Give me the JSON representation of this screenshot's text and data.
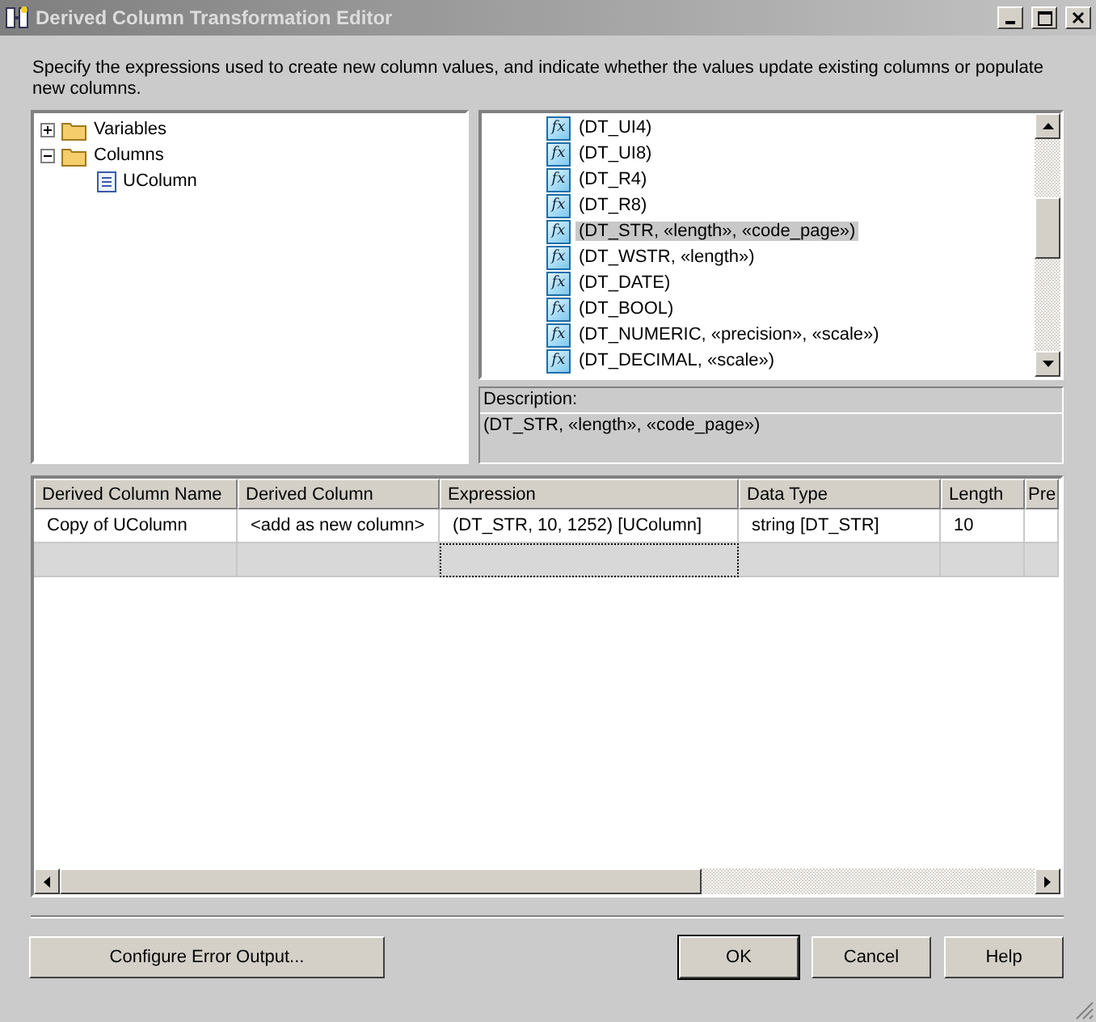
{
  "window": {
    "title": "Derived Column Transformation Editor"
  },
  "instructions": "Specify the expressions used to create new column values, and indicate whether the values update existing columns or populate new columns.",
  "tree": [
    {
      "label": "Variables",
      "kind": "folder",
      "expanded": false
    },
    {
      "label": "Columns",
      "kind": "folder",
      "expanded": true,
      "children": [
        {
          "label": "UColumn",
          "kind": "column"
        }
      ]
    }
  ],
  "functions": [
    {
      "icon": "fx",
      "label": "(DT_UI4)",
      "selected": false
    },
    {
      "icon": "fx",
      "label": "(DT_UI8)",
      "selected": false
    },
    {
      "icon": "fx",
      "label": "(DT_R4)",
      "selected": false
    },
    {
      "icon": "fx",
      "label": "(DT_R8)",
      "selected": false
    },
    {
      "icon": "fx",
      "label": "(DT_STR, «length», «code_page»)",
      "selected": true
    },
    {
      "icon": "fx",
      "label": "(DT_WSTR, «length»)",
      "selected": false
    },
    {
      "icon": "fx",
      "label": "(DT_DATE)",
      "selected": false
    },
    {
      "icon": "fx",
      "label": "(DT_BOOL)",
      "selected": false
    },
    {
      "icon": "fx",
      "label": "(DT_NUMERIC, «precision», «scale»)",
      "selected": false
    },
    {
      "icon": "fx",
      "label": "(DT_DECIMAL, «scale»)",
      "selected": false
    }
  ],
  "description": {
    "label": "Description:",
    "text": "(DT_STR, «length», «code_page»)"
  },
  "grid": {
    "columns": [
      {
        "label": "Derived Column Name",
        "focused": false
      },
      {
        "label": "Derived Column",
        "focused": false
      },
      {
        "label": "Expression",
        "focused": true
      },
      {
        "label": "Data Type",
        "focused": false
      },
      {
        "label": "Length",
        "focused": false
      },
      {
        "label": "Pre",
        "focused": false
      }
    ],
    "rows": [
      [
        "Copy of UColumn",
        "<add as new column>",
        "(DT_STR, 10, 1252) [UColumn]",
        "string [DT_STR]",
        "10"
      ]
    ]
  },
  "buttons": {
    "configure": "Configure Error Output...",
    "ok": "OK",
    "cancel": "Cancel",
    "help": "Help"
  }
}
